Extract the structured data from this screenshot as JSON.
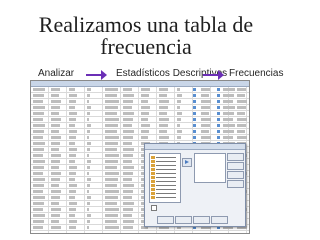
{
  "slide": {
    "title": "Realizamos una tabla de frecuencia"
  },
  "workflow": {
    "steps": [
      "Analizar",
      "Estadísticos Descriptivos",
      "Frecuencias"
    ],
    "arrow_color": "#6b2fb6"
  },
  "screenshot": {
    "description_icon": "spss-data-view-icon"
  }
}
